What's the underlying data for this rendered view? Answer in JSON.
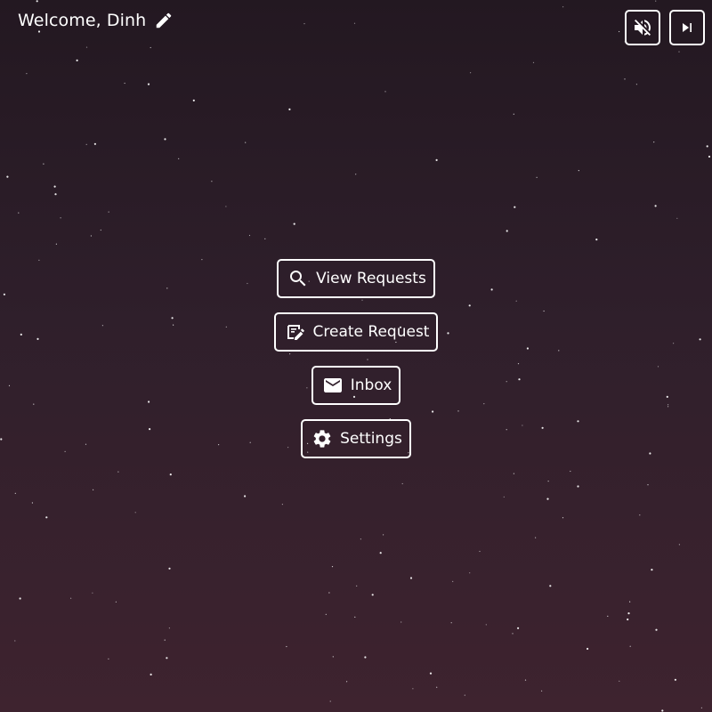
{
  "greeting": {
    "text": "Welcome, Dinh",
    "edit_icon": "pencil-icon"
  },
  "media_controls": {
    "mute_icon": "volume-off-icon",
    "skip_icon": "skip-next-icon"
  },
  "menu": {
    "view_requests": {
      "label": "View Requests",
      "icon": "search-icon"
    },
    "create_request": {
      "label": "Create Request",
      "icon": "edit-note-icon"
    },
    "inbox": {
      "label": "Inbox",
      "icon": "mail-icon"
    },
    "settings": {
      "label": "Settings",
      "icon": "gear-icon"
    }
  },
  "colors": {
    "background_top": "#231821",
    "background_bottom": "#3e232f",
    "foreground": "#ffffff"
  }
}
